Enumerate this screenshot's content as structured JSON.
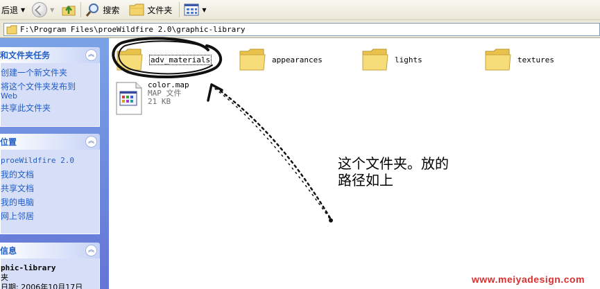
{
  "toolbar": {
    "back_label": "后退",
    "search_label": "搜索",
    "folders_label": "文件夹"
  },
  "address": {
    "path": "F:\\Program Files\\proeWildfire 2.0\\graphic-library"
  },
  "task_pane": {
    "tasks": {
      "title": "和文件夹任务",
      "items": [
        "创建一个新文件夹",
        "将这个文件夹发布到",
        "Web",
        "共享此文件夹"
      ]
    },
    "places": {
      "title": "位置",
      "items": [
        "proeWildfire 2.0",
        "我的文档",
        "共享文档",
        "我的电脑",
        "网上邻居"
      ]
    },
    "details": {
      "title": "信息",
      "name": "phic-library",
      "type": "夹",
      "modified": "日期: 2006年10月17日"
    }
  },
  "content": {
    "folders": [
      {
        "name": "adv_materials"
      },
      {
        "name": "appearances"
      },
      {
        "name": "lights"
      },
      {
        "name": "textures"
      }
    ],
    "file": {
      "name": "color.map",
      "type": "MAP 文件",
      "size": "21 KB"
    }
  },
  "annotation": {
    "line1": "这个文件夹。放的",
    "line2": "路径如上"
  },
  "watermark": "www.meiyadesign.com",
  "colors": {
    "taskpane_blue": "#6375d6",
    "link_blue": "#215dc6",
    "watermark_red": "#d83030"
  }
}
